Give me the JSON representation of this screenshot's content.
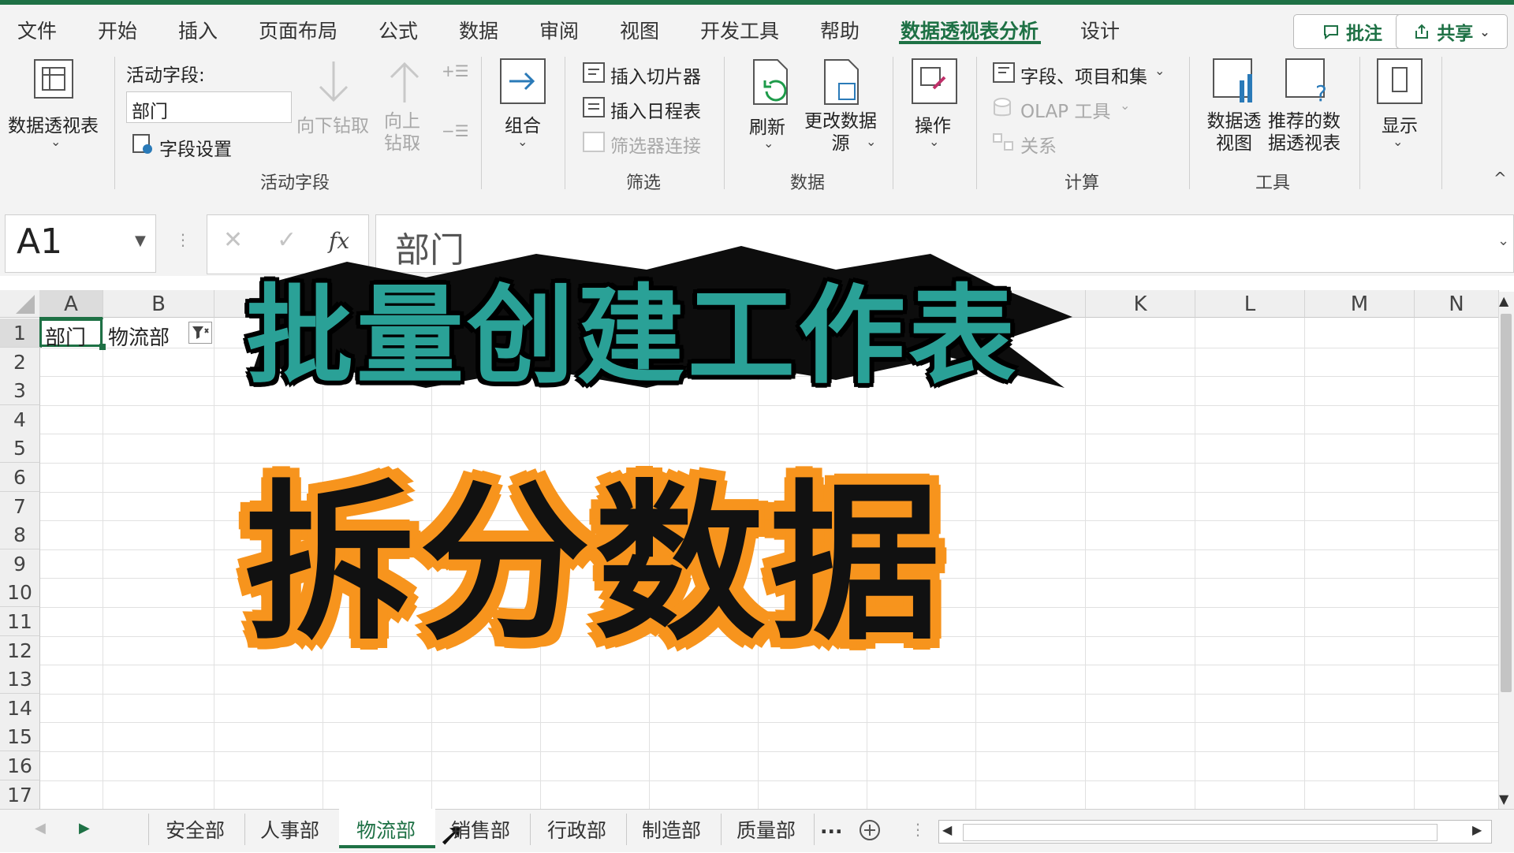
{
  "ribbon_tabs": [
    "文件",
    "开始",
    "插入",
    "页面布局",
    "公式",
    "数据",
    "审阅",
    "视图",
    "开发工具",
    "帮助",
    "数据透视表分析",
    "设计"
  ],
  "active_tab": "数据透视表分析",
  "top_buttons": {
    "comments": "批注",
    "share": "共享"
  },
  "ribbon": {
    "pivot_table": "数据透视表",
    "active_field_label": "活动字段:",
    "active_field_value": "部门",
    "field_settings": "字段设置",
    "drill_down": "向下钻取",
    "drill_up": "向上钻取",
    "group_active_field": "活动字段",
    "group_combine": "组合",
    "insert_slicer": "插入切片器",
    "insert_timeline": "插入日程表",
    "filter_connections": "筛选器连接",
    "group_filter": "筛选",
    "refresh": "刷新",
    "change_source": "更改数据源",
    "group_data": "数据",
    "actions": "操作",
    "fields_items_sets": "字段、项目和集",
    "olap_tools": "OLAP 工具",
    "relationships": "关系",
    "group_calc": "计算",
    "pivot_chart": "数据透视图",
    "recommended_pivot": "推荐的数据透视表",
    "group_tools": "工具",
    "show": "显示"
  },
  "formula_bar": {
    "name_box": "A1",
    "fx": "fx",
    "content": "部门"
  },
  "columns_visible": [
    "A",
    "B",
    "K",
    "L",
    "M",
    "N"
  ],
  "rows": [
    "1",
    "2",
    "3",
    "4",
    "5",
    "6",
    "7",
    "8",
    "9",
    "10",
    "11",
    "12",
    "13",
    "14",
    "15",
    "16",
    "17"
  ],
  "cells": {
    "A1": "部门",
    "B1": "物流部"
  },
  "overlay": {
    "title_line1": "批量创建工作表",
    "title_line2": "拆分数据"
  },
  "sheet_tabs": [
    "安全部",
    "人事部",
    "物流部",
    "销售部",
    "行政部",
    "制造部",
    "质量部"
  ],
  "active_sheet": "物流部",
  "sheet_more": "...",
  "colors": {
    "accent": "#1e7145",
    "title_teal": "#2a9d8f",
    "title_orange": "#f7941d"
  }
}
